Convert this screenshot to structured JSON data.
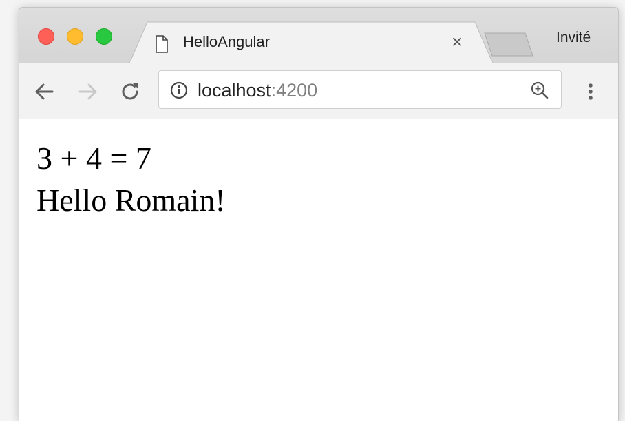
{
  "browser": {
    "tab": {
      "title": "HelloAngular",
      "close_glyph": "×",
      "icon": "document-icon"
    },
    "profile_label": "Invité",
    "address_bar": {
      "host": "localhost",
      "port": ":4200",
      "info_icon": "info-icon",
      "zoom_icon": "zoom-in-icon"
    },
    "nav": {
      "back_icon": "back-arrow-icon",
      "forward_icon": "forward-arrow-icon",
      "reload_icon": "reload-icon",
      "menu_icon": "more-vert-icon"
    }
  },
  "page": {
    "lines": [
      "3 + 4 = 7",
      "Hello Romain!"
    ]
  },
  "colors": {
    "close": "#fe5f57",
    "minimize": "#febc2e",
    "maximize": "#28c840",
    "port_text": "#808080"
  }
}
